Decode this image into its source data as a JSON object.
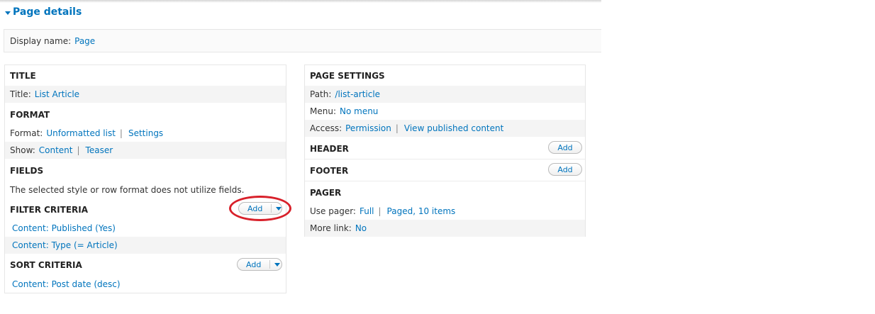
{
  "header": {
    "title": "Page details"
  },
  "display": {
    "label": "Display name:",
    "value": "Page"
  },
  "col1": {
    "title": {
      "heading": "TITLE",
      "row_label": "Title:",
      "row_value": "List Article"
    },
    "format": {
      "heading": "FORMAT",
      "format_label": "Format:",
      "format_value": "Unformatted list",
      "format_sep": "|",
      "format_settings": "Settings",
      "show_label": "Show:",
      "show_value": "Content",
      "show_sep": "|",
      "show_value2": "Teaser"
    },
    "fields": {
      "heading": "FIELDS",
      "note": "The selected style or row format does not utilize fields."
    },
    "filter": {
      "heading": "FILTER CRITERIA",
      "add_label": "Add",
      "items": [
        "Content: Published (Yes)",
        "Content: Type (= Article)"
      ]
    },
    "sort": {
      "heading": "SORT CRITERIA",
      "add_label": "Add",
      "items": [
        "Content: Post date (desc)"
      ]
    }
  },
  "col2": {
    "page_settings": {
      "heading": "PAGE SETTINGS",
      "path_label": "Path:",
      "path_value": "/list-article",
      "menu_label": "Menu:",
      "menu_value": "No menu",
      "access_label": "Access:",
      "access_value": "Permission",
      "access_sep": "|",
      "access_value2": "View published content"
    },
    "header": {
      "heading": "HEADER",
      "add_label": "Add"
    },
    "footer": {
      "heading": "FOOTER",
      "add_label": "Add"
    },
    "pager": {
      "heading": "PAGER",
      "use_label": "Use pager:",
      "use_value": "Full",
      "use_sep": "|",
      "use_value2": "Paged, 10 items",
      "more_label": "More link:",
      "more_value": "No"
    }
  },
  "colors": {
    "link": "#0074bd",
    "highlight": "#d8202a"
  }
}
